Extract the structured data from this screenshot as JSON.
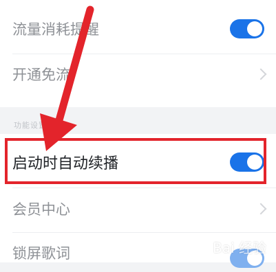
{
  "settings": {
    "rows": [
      {
        "label": "流量消耗提醒",
        "control": "toggle",
        "state": "on"
      },
      {
        "label": "开通免流",
        "control": "chevron"
      },
      {
        "label": "启动时自动续播",
        "control": "toggle",
        "state": "on"
      },
      {
        "label": "会员中心",
        "control": "chevron"
      },
      {
        "label": "锁屏歌词",
        "control": "toggle",
        "state": "on"
      }
    ],
    "section_header": "功能设置"
  },
  "watermark": "Bai 经验",
  "colors": {
    "accent": "#1a73e8",
    "annotation": "#e3242b",
    "background": "#f2f3f5"
  },
  "icons": [
    "chevron-right-icon",
    "toggle-switch",
    "arrow-annotation"
  ]
}
